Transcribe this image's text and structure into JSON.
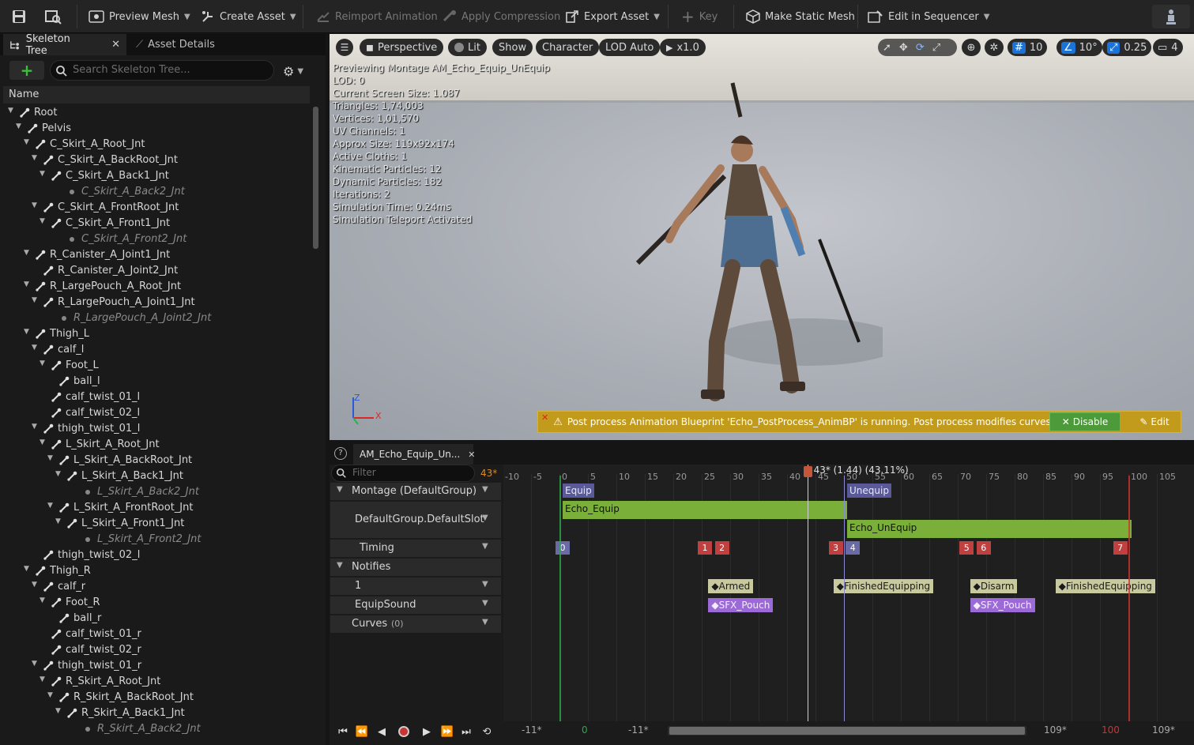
{
  "toolbar": {
    "preview_mesh": "Preview Mesh",
    "create_asset": "Create Asset",
    "reimport_animation": "Reimport Animation",
    "apply_compression": "Apply Compression",
    "export_asset": "Export Asset",
    "key": "Key",
    "make_static_mesh": "Make Static Mesh",
    "edit_in_sequencer": "Edit in Sequencer"
  },
  "left_panel": {
    "tab_skeleton_tree": "Skeleton Tree",
    "tab_asset_details": "Asset Details",
    "search_placeholder": "Search Skeleton Tree...",
    "column_name": "Name",
    "bones": [
      {
        "label": "Root",
        "depth": 0,
        "type": "open"
      },
      {
        "label": "Pelvis",
        "depth": 1,
        "type": "open"
      },
      {
        "label": "C_Skirt_A_Root_Jnt",
        "depth": 2,
        "type": "open"
      },
      {
        "label": "C_Skirt_A_BackRoot_Jnt",
        "depth": 3,
        "type": "open"
      },
      {
        "label": "C_Skirt_A_Back1_Jnt",
        "depth": 4,
        "type": "open"
      },
      {
        "label": "C_Skirt_A_Back2_Jnt",
        "depth": 5,
        "type": "leaf"
      },
      {
        "label": "C_Skirt_A_FrontRoot_Jnt",
        "depth": 3,
        "type": "open"
      },
      {
        "label": "C_Skirt_A_Front1_Jnt",
        "depth": 4,
        "type": "open"
      },
      {
        "label": "C_Skirt_A_Front2_Jnt",
        "depth": 5,
        "type": "leaf"
      },
      {
        "label": "R_Canister_A_Joint1_Jnt",
        "depth": 2,
        "type": "open"
      },
      {
        "label": "R_Canister_A_Joint2_Jnt",
        "depth": 3,
        "type": "bone"
      },
      {
        "label": "R_LargePouch_A_Root_Jnt",
        "depth": 2,
        "type": "open"
      },
      {
        "label": "R_LargePouch_A_Joint1_Jnt",
        "depth": 3,
        "type": "open"
      },
      {
        "label": "R_LargePouch_A_Joint2_Jnt",
        "depth": 4,
        "type": "leaf"
      },
      {
        "label": "Thigh_L",
        "depth": 2,
        "type": "open"
      },
      {
        "label": "calf_l",
        "depth": 3,
        "type": "open"
      },
      {
        "label": "Foot_L",
        "depth": 4,
        "type": "open"
      },
      {
        "label": "ball_l",
        "depth": 5,
        "type": "bone"
      },
      {
        "label": "calf_twist_01_l",
        "depth": 4,
        "type": "bone"
      },
      {
        "label": "calf_twist_02_l",
        "depth": 4,
        "type": "bone"
      },
      {
        "label": "thigh_twist_01_l",
        "depth": 3,
        "type": "open"
      },
      {
        "label": "L_Skirt_A_Root_Jnt",
        "depth": 4,
        "type": "open"
      },
      {
        "label": "L_Skirt_A_BackRoot_Jnt",
        "depth": 5,
        "type": "open"
      },
      {
        "label": "L_Skirt_A_Back1_Jnt",
        "depth": 6,
        "type": "open"
      },
      {
        "label": "L_Skirt_A_Back2_Jnt",
        "depth": 7,
        "type": "leaf"
      },
      {
        "label": "L_Skirt_A_FrontRoot_Jnt",
        "depth": 5,
        "type": "open"
      },
      {
        "label": "L_Skirt_A_Front1_Jnt",
        "depth": 6,
        "type": "open"
      },
      {
        "label": "L_Skirt_A_Front2_Jnt",
        "depth": 7,
        "type": "leaf"
      },
      {
        "label": "thigh_twist_02_l",
        "depth": 3,
        "type": "bone"
      },
      {
        "label": "Thigh_R",
        "depth": 2,
        "type": "open"
      },
      {
        "label": "calf_r",
        "depth": 3,
        "type": "open"
      },
      {
        "label": "Foot_R",
        "depth": 4,
        "type": "open"
      },
      {
        "label": "ball_r",
        "depth": 5,
        "type": "bone"
      },
      {
        "label": "calf_twist_01_r",
        "depth": 4,
        "type": "bone"
      },
      {
        "label": "calf_twist_02_r",
        "depth": 4,
        "type": "bone"
      },
      {
        "label": "thigh_twist_01_r",
        "depth": 3,
        "type": "open"
      },
      {
        "label": "R_Skirt_A_Root_Jnt",
        "depth": 4,
        "type": "open"
      },
      {
        "label": "R_Skirt_A_BackRoot_Jnt",
        "depth": 5,
        "type": "open"
      },
      {
        "label": "R_Skirt_A_Back1_Jnt",
        "depth": 6,
        "type": "open"
      },
      {
        "label": "R_Skirt_A_Back2_Jnt",
        "depth": 7,
        "type": "leaf"
      }
    ]
  },
  "viewport": {
    "btn_perspective": "Perspective",
    "btn_lit": "Lit",
    "btn_show": "Show",
    "btn_character": "Character",
    "btn_lod": "LOD Auto",
    "btn_speed": "x1.0",
    "grid_value": "10",
    "angle_value": "10°",
    "scale_value": "0.25",
    "camera_speed": "4",
    "stats": [
      "Previewing Montage AM_Echo_Equip_UnEquip",
      "LOD: 0",
      "Current Screen Size: 1.087",
      "Triangles: 1,74,003",
      "Vertices: 1,01,570",
      "UV Channels: 1",
      "Approx Size: 119x92x174",
      "Active Cloths: 1",
      "Kinematic Particles: 12",
      "Dynamic Particles: 182",
      "Iterations: 2",
      "Simulation Time: 0.24ms",
      "Simulation Teleport Activated"
    ],
    "axis_z": "Z",
    "axis_x": "X",
    "warning_text": "Post process Animation Blueprint 'Echo_PostProcess_AnimBP' is running. Post process modifies curves.",
    "disable_label": "Disable",
    "edit_label": "Edit"
  },
  "timeline": {
    "tab_label": "AM_Echo_Equip_Un...",
    "filter_placeholder": "Filter",
    "frame_badge": "43",
    "playhead_label": "43* (1.44) (43.11%)",
    "tracks": {
      "montage": "Montage (DefaultGroup)",
      "slot": "DefaultGroup.DefaultSlot",
      "timing": "Timing",
      "notifies": "Notifies",
      "notify_track_1": "1",
      "equip_sound": "EquipSound",
      "curves": "Curves",
      "curves_count": "(0)"
    },
    "ticks": [
      "-10",
      "-5",
      "0",
      "5",
      "10",
      "15",
      "20",
      "25",
      "30",
      "35",
      "40",
      "45",
      "50",
      "55",
      "60",
      "65",
      "70",
      "75",
      "80",
      "85",
      "90",
      "95",
      "100",
      "105"
    ],
    "sections": [
      {
        "label": "Equip",
        "frame": 0
      },
      {
        "label": "Unequip",
        "frame": 50
      }
    ],
    "segments": [
      {
        "label": "Echo_Equip",
        "start": 0,
        "end": 50
      },
      {
        "label": "Echo_UnEquip",
        "start": 50,
        "end": 100
      }
    ],
    "timing_markers": [
      {
        "label": "0",
        "frame": 0,
        "color": "#6a6aa6"
      },
      {
        "label": "1",
        "frame": 25,
        "color": "#c04040"
      },
      {
        "label": "2",
        "frame": 28,
        "color": "#c04040"
      },
      {
        "label": "3",
        "frame": 48,
        "color": "#c04040"
      },
      {
        "label": "4",
        "frame": 51,
        "color": "#6a6aa6"
      },
      {
        "label": "5",
        "frame": 71,
        "color": "#c04040"
      },
      {
        "label": "6",
        "frame": 74,
        "color": "#c04040"
      },
      {
        "label": "7",
        "frame": 98,
        "color": "#c04040"
      }
    ],
    "notifies": [
      {
        "label": "Armed",
        "frame": 27,
        "row": 0
      },
      {
        "label": "FinishedEquipping",
        "frame": 49,
        "row": 0
      },
      {
        "label": "Disarm",
        "frame": 73,
        "row": 0
      },
      {
        "label": "FinishedEquipping",
        "frame": 88,
        "row": 0
      },
      {
        "label": "SFX_Pouch",
        "frame": 27,
        "row": 1
      },
      {
        "label": "SFX_Pouch",
        "frame": 73,
        "row": 1
      }
    ],
    "playhead_frame": 43,
    "footer": {
      "left_a": "-11*",
      "left_b": "0",
      "left_c": "-11*",
      "right_a": "109*",
      "right_b": "100",
      "right_c": "109*"
    }
  },
  "colors": {
    "accent_blue": "#1a73d9",
    "green_track": "#7ab03a",
    "warning": "#c29b1c",
    "disable_green": "#4c9a3a"
  }
}
